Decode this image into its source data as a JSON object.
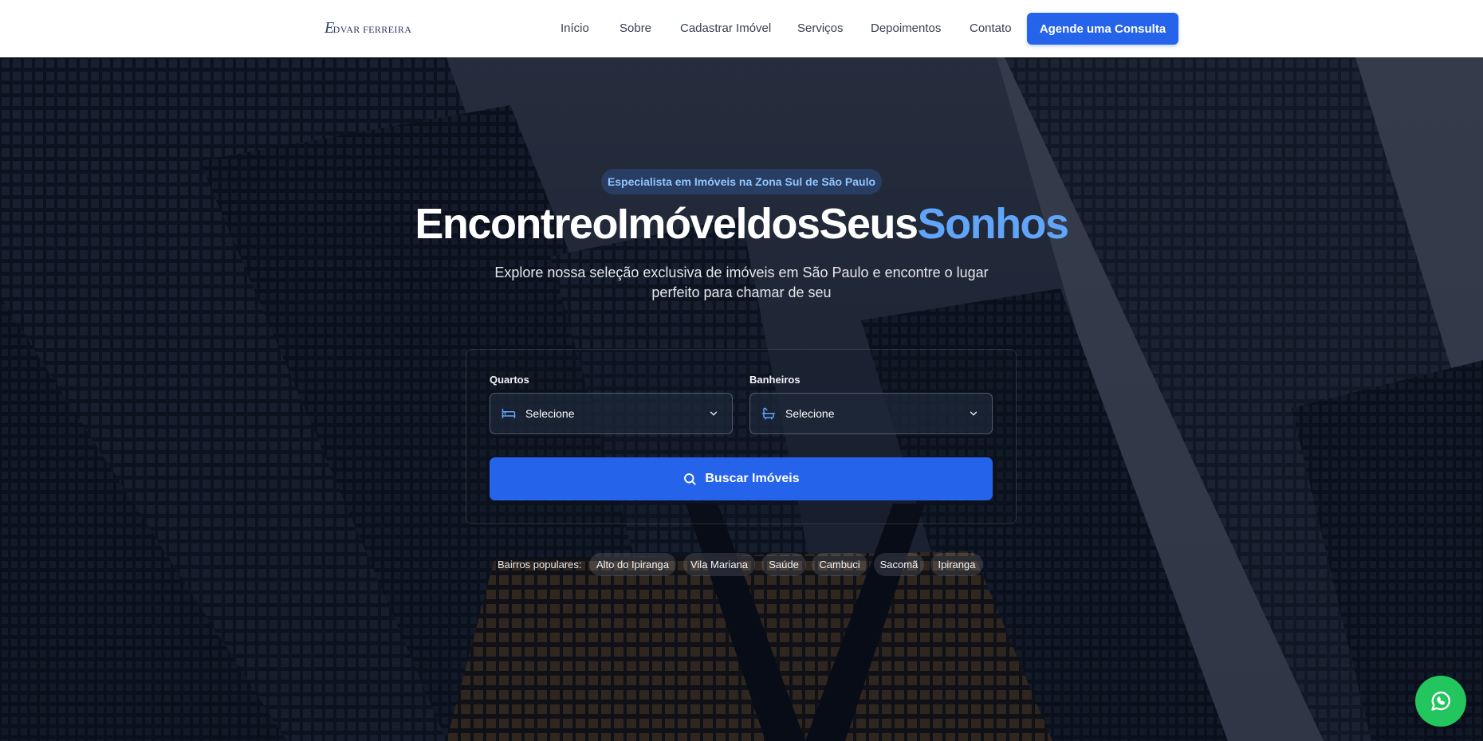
{
  "brand": {
    "logo_text": "EDVAR FERREIRA",
    "logo_initial": "E",
    "logo_rest": "DVAR FERREIRA"
  },
  "nav": {
    "items": [
      {
        "label": "Início"
      },
      {
        "label": "Sobre"
      },
      {
        "label": "Cadastrar Imóvel"
      },
      {
        "label": "Serviços"
      },
      {
        "label": "Depoimentos"
      },
      {
        "label": "Contato"
      }
    ],
    "cta_label": "Agende uma Consulta"
  },
  "hero": {
    "badge": "Especialista em Imóveis na Zona Sul de São Paulo",
    "title_main": "EncontreoImóveldosSeus",
    "title_accent": "Sonhos",
    "subtitle": "Explore nossa seleção exclusiva de imóveis em São Paulo e encontre o lugar perfeito para chamar de seu"
  },
  "search": {
    "rooms": {
      "label": "Quartos",
      "value": "Selecione",
      "icon": "bed-icon"
    },
    "baths": {
      "label": "Banheiros",
      "value": "Selecione",
      "icon": "bath-icon"
    },
    "button_label": "Buscar Imóveis"
  },
  "popular": {
    "label": "Bairros populares:",
    "neighborhoods": [
      "Alto do Ipiranga",
      "Vila Mariana",
      "Saúde",
      "Cambuci",
      "Sacomã",
      "Ipiranga"
    ]
  },
  "colors": {
    "accent": "#2563eb",
    "accent_light": "#60a5fa",
    "whatsapp": "#22c55e"
  },
  "whatsapp": {
    "icon": "whatsapp-icon"
  }
}
